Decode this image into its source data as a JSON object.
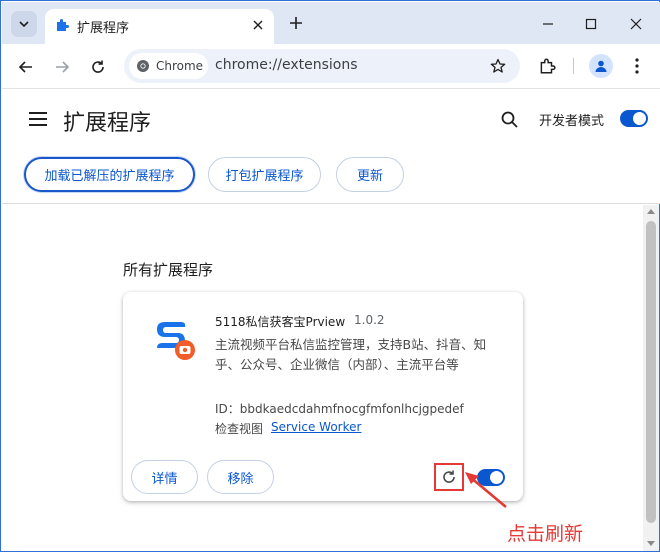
{
  "browser": {
    "tab": {
      "title": "扩展程序",
      "icon": "puzzle-icon"
    },
    "chip_label": "Chrome",
    "url": "chrome://extensions"
  },
  "header": {
    "title": "扩展程序",
    "dev_mode_label": "开发者模式",
    "dev_mode_on": true,
    "buttons": {
      "load_unpacked": "加载已解压的扩展程序",
      "pack": "打包扩展程序",
      "update": "更新"
    }
  },
  "section_title": "所有扩展程序",
  "extension": {
    "name": "5118私信获客宝Prview",
    "version": "1.0.2",
    "description": "主流视频平台私信监控管理，支持B站、抖音、知乎、公众号、企业微信（内部）、主流平台等",
    "id_label": "ID：bbdkaedcdahmfnocgfmfonlhcjgpedef",
    "views_label": "检查视图",
    "views_link": "Service Worker",
    "details_label": "详情",
    "remove_label": "移除",
    "enabled": true
  },
  "annotation": {
    "text": "点击刷新",
    "color": "#e53935"
  },
  "colors": {
    "accent": "#0b57d0",
    "tabstrip": "#dfe6f4",
    "annotation": "#e53935"
  }
}
